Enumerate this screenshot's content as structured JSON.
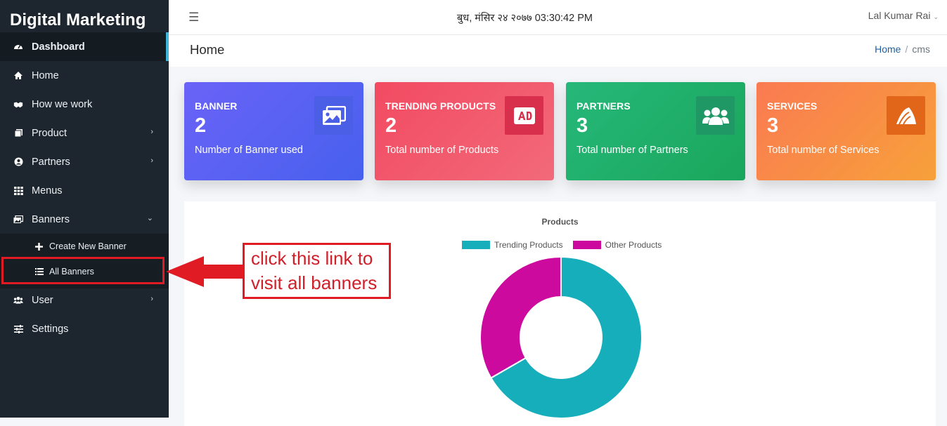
{
  "sidebar": {
    "brand": "Digital Marketing",
    "items": [
      {
        "label": "Dashboard",
        "icon": "tachometer-icon"
      },
      {
        "label": "Home",
        "icon": "home-icon"
      },
      {
        "label": "How we work",
        "icon": "handshake-icon"
      },
      {
        "label": "Product",
        "icon": "clone-icon"
      },
      {
        "label": "Partners",
        "icon": "user-circle-icon"
      },
      {
        "label": "Menus",
        "icon": "grid-icon"
      },
      {
        "label": "Banners",
        "icon": "images-icon"
      },
      {
        "label": "User",
        "icon": "users-icon"
      },
      {
        "label": "Settings",
        "icon": "sliders-icon"
      }
    ],
    "banners_submenu": [
      {
        "label": "Create New Banner",
        "icon": "plus-icon"
      },
      {
        "label": "All Banners",
        "icon": "list-icon"
      }
    ]
  },
  "topbar": {
    "datetime": "बुध, मंसिर २४ २०७७ 03:30:42 PM",
    "user": "Lal Kumar Rai"
  },
  "header": {
    "title": "Home",
    "breadcrumb": [
      "Home",
      "cms"
    ]
  },
  "cards": [
    {
      "title": "BANNER",
      "value": "2",
      "subtitle": "Number of Banner used",
      "icon": "images-icon",
      "color": "#5a62f3"
    },
    {
      "title": "TRENDING PRODUCTS",
      "value": "2",
      "subtitle": "Total number of Products",
      "icon": "ad-icon",
      "color": "#f25468"
    },
    {
      "title": "PARTNERS",
      "value": "3",
      "subtitle": "Total number of Partners",
      "icon": "users-icon",
      "color": "#20b06a"
    },
    {
      "title": "SERVICES",
      "value": "3",
      "subtitle": "Total number of Services",
      "icon": "shark-fin-icon",
      "color": "#f8853f"
    }
  ],
  "chart_data": {
    "type": "pie",
    "title": "Products",
    "categories": [
      "Trending Products",
      "Other Products"
    ],
    "values": [
      2,
      1
    ],
    "colors": [
      "#17aebb",
      "#cc0a9d"
    ],
    "legend": "top"
  },
  "annotation": {
    "lines": [
      "click this link to",
      "visit all banners"
    ],
    "color": "#e01b24"
  }
}
